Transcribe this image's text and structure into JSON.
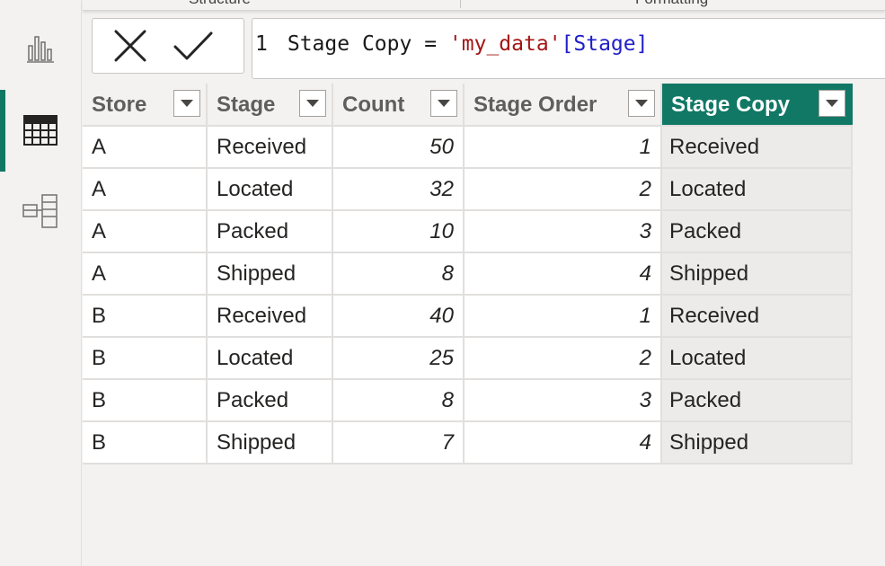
{
  "ribbon": {
    "groups": [
      "Structure",
      "Formatting"
    ]
  },
  "rail": {
    "items": [
      {
        "name": "report-view",
        "icon": "bar-chart-icon",
        "active": false
      },
      {
        "name": "table-view",
        "icon": "table-grid-icon",
        "active": true
      },
      {
        "name": "model-view",
        "icon": "model-diagram-icon",
        "active": false
      }
    ],
    "accent": "#117865"
  },
  "formula_bar": {
    "cancel_icon": "close-icon",
    "commit_icon": "checkmark-icon",
    "line_number": "1",
    "measure_name": "Stage Copy",
    "operator": "=",
    "table_ref": "'my_data'",
    "column_ref": "[Stage]"
  },
  "table": {
    "columns": [
      "Store",
      "Stage",
      "Count",
      "Stage Order",
      "Stage Copy"
    ],
    "selected_column": "Stage Copy",
    "rows": [
      [
        "A",
        "Received",
        "50",
        "1",
        "Received"
      ],
      [
        "A",
        "Located",
        "32",
        "2",
        "Located"
      ],
      [
        "A",
        "Packed",
        "10",
        "3",
        "Packed"
      ],
      [
        "A",
        "Shipped",
        "8",
        "4",
        "Shipped"
      ],
      [
        "B",
        "Received",
        "40",
        "1",
        "Received"
      ],
      [
        "B",
        "Located",
        "25",
        "2",
        "Located"
      ],
      [
        "B",
        "Packed",
        "8",
        "3",
        "Packed"
      ],
      [
        "B",
        "Shipped",
        "7",
        "4",
        "Shipped"
      ]
    ]
  }
}
